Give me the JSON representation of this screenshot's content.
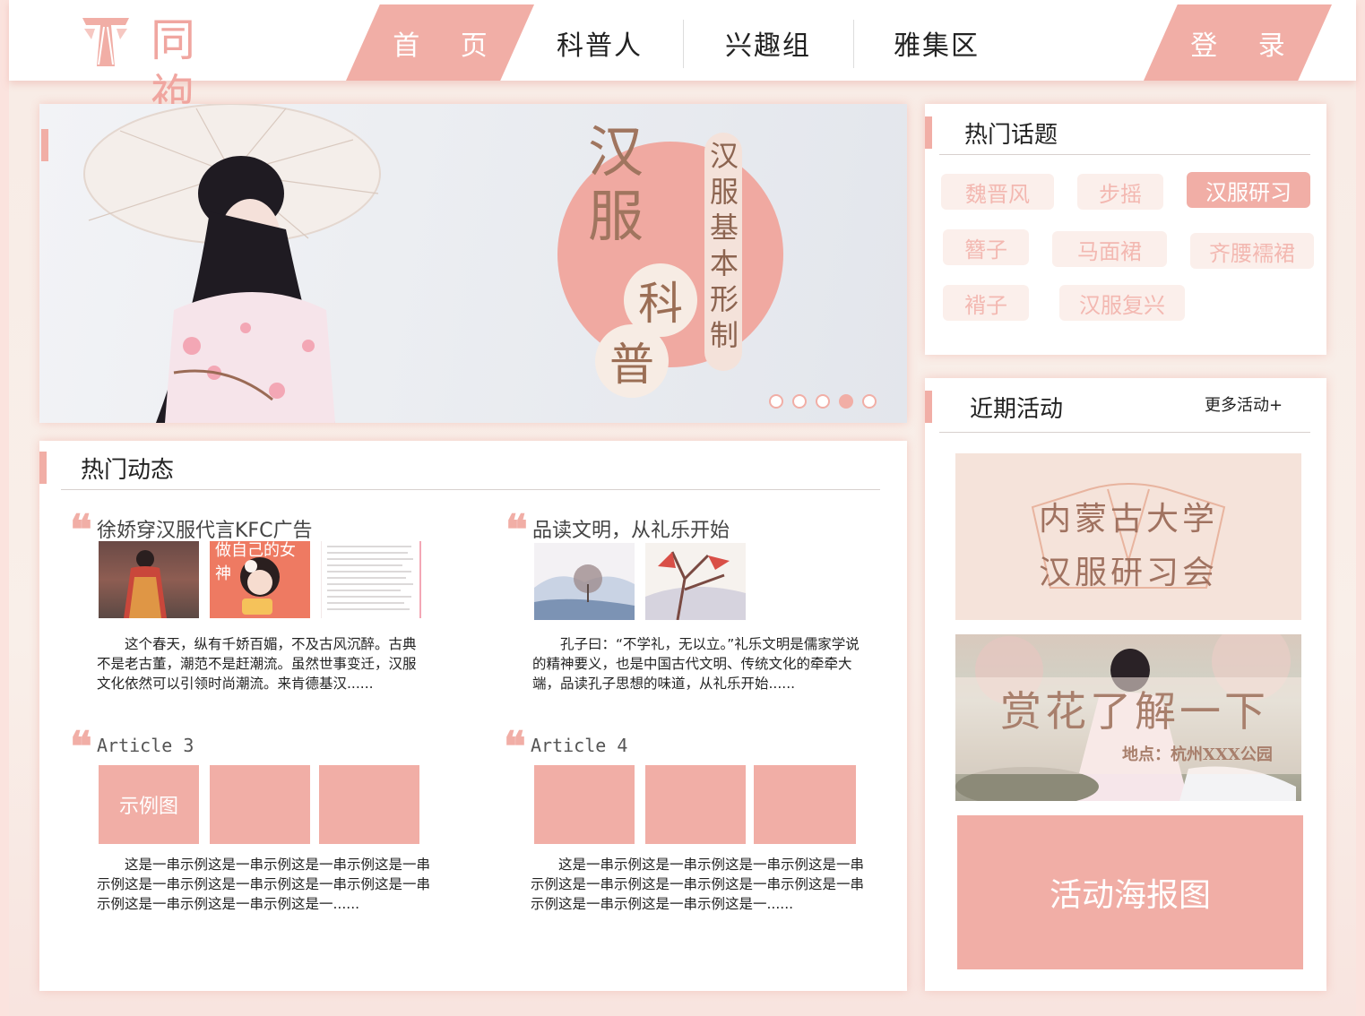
{
  "header": {
    "logo_text": "同袍",
    "nav": [
      {
        "label": "首 页",
        "active": true
      },
      {
        "label": "科普人"
      },
      {
        "label": "兴趣组"
      },
      {
        "label": "雅集区"
      }
    ],
    "login_label": "登 录"
  },
  "banner": {
    "big_chars": "汉服",
    "vertical_text": "汉服基本形制",
    "circle_chars": [
      "科",
      "普"
    ],
    "slide_count": 5,
    "active_slide": 4
  },
  "topics": {
    "title": "热门话题",
    "tags": [
      "魏晋风",
      "步摇",
      "汉服研习",
      "簪子",
      "马面裙",
      "齐腰襦裙",
      "褙子",
      "汉服复兴"
    ],
    "active_tag": "汉服研习"
  },
  "activities": {
    "title": "近期活动",
    "more_label": "更多活动+",
    "card1": {
      "line1": "内蒙古大学",
      "line2": "汉服研习会"
    },
    "card2": {
      "title": "赏花了解一下",
      "location": "地点：杭州XXX公园"
    },
    "poster_label": "活动海报图"
  },
  "feed": {
    "title": "热门动态",
    "posts": [
      {
        "title": "徐娇穿汉服代言KFC广告",
        "body": "这个春天，纵有千娇百媚，不及古风沉醉。古典不是老古董，潮范不是赶潮流。虽然世事变迁，汉服文化依然可以引领时尚潮流。来肯德基汉......",
        "thumb_caption": "做自己的女神"
      },
      {
        "title": "品读文明，从礼乐开始",
        "body": "孔子曰：“不学礼，无以立。”礼乐文明是儒家学说的精神要义，也是中国古代文明、传统文化的牵牵大端，品读孔子思想的味道，从礼乐开始......"
      },
      {
        "title": "Article 3",
        "body": "这是一串示例这是一串示例这是一串示例这是一串示例这是一串示例这是一串示例这是一串示例这是一串示例这是一串示例这是一串示例这是一......",
        "placeholder_label": "示例图"
      },
      {
        "title": "Article 4",
        "body": "这是一串示例这是一串示例这是一串示例这是一串示例这是一串示例这是一串示例这是一串示例这是一串示例这是一串示例这是一串示例这是一......"
      }
    ]
  },
  "colors": {
    "accent": "#f1aea6",
    "tag_bg": "#fbefeb",
    "tag_text": "#f3b8b1",
    "brown": "#a0755f"
  }
}
